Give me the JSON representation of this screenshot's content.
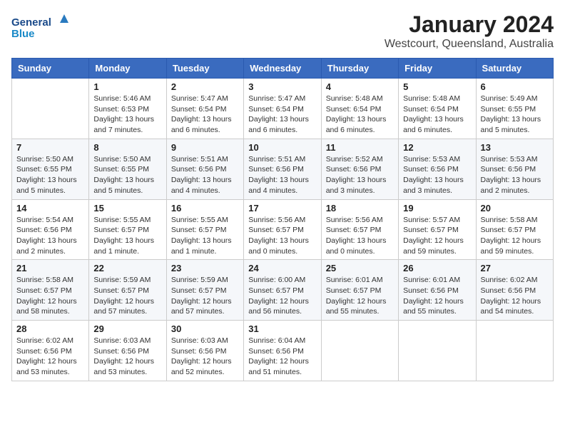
{
  "header": {
    "logo_text_general": "General",
    "logo_text_blue": "Blue",
    "title": "January 2024",
    "subtitle": "Westcourt, Queensland, Australia"
  },
  "calendar": {
    "days_of_week": [
      "Sunday",
      "Monday",
      "Tuesday",
      "Wednesday",
      "Thursday",
      "Friday",
      "Saturday"
    ],
    "weeks": [
      [
        {
          "day": "",
          "info": ""
        },
        {
          "day": "1",
          "info": "Sunrise: 5:46 AM\nSunset: 6:53 PM\nDaylight: 13 hours and 7 minutes."
        },
        {
          "day": "2",
          "info": "Sunrise: 5:47 AM\nSunset: 6:54 PM\nDaylight: 13 hours and 6 minutes."
        },
        {
          "day": "3",
          "info": "Sunrise: 5:47 AM\nSunset: 6:54 PM\nDaylight: 13 hours and 6 minutes."
        },
        {
          "day": "4",
          "info": "Sunrise: 5:48 AM\nSunset: 6:54 PM\nDaylight: 13 hours and 6 minutes."
        },
        {
          "day": "5",
          "info": "Sunrise: 5:48 AM\nSunset: 6:54 PM\nDaylight: 13 hours and 6 minutes."
        },
        {
          "day": "6",
          "info": "Sunrise: 5:49 AM\nSunset: 6:55 PM\nDaylight: 13 hours and 5 minutes."
        }
      ],
      [
        {
          "day": "7",
          "info": "Sunrise: 5:50 AM\nSunset: 6:55 PM\nDaylight: 13 hours and 5 minutes."
        },
        {
          "day": "8",
          "info": "Sunrise: 5:50 AM\nSunset: 6:55 PM\nDaylight: 13 hours and 5 minutes."
        },
        {
          "day": "9",
          "info": "Sunrise: 5:51 AM\nSunset: 6:56 PM\nDaylight: 13 hours and 4 minutes."
        },
        {
          "day": "10",
          "info": "Sunrise: 5:51 AM\nSunset: 6:56 PM\nDaylight: 13 hours and 4 minutes."
        },
        {
          "day": "11",
          "info": "Sunrise: 5:52 AM\nSunset: 6:56 PM\nDaylight: 13 hours and 3 minutes."
        },
        {
          "day": "12",
          "info": "Sunrise: 5:53 AM\nSunset: 6:56 PM\nDaylight: 13 hours and 3 minutes."
        },
        {
          "day": "13",
          "info": "Sunrise: 5:53 AM\nSunset: 6:56 PM\nDaylight: 13 hours and 2 minutes."
        }
      ],
      [
        {
          "day": "14",
          "info": "Sunrise: 5:54 AM\nSunset: 6:56 PM\nDaylight: 13 hours and 2 minutes."
        },
        {
          "day": "15",
          "info": "Sunrise: 5:55 AM\nSunset: 6:57 PM\nDaylight: 13 hours and 1 minute."
        },
        {
          "day": "16",
          "info": "Sunrise: 5:55 AM\nSunset: 6:57 PM\nDaylight: 13 hours and 1 minute."
        },
        {
          "day": "17",
          "info": "Sunrise: 5:56 AM\nSunset: 6:57 PM\nDaylight: 13 hours and 0 minutes."
        },
        {
          "day": "18",
          "info": "Sunrise: 5:56 AM\nSunset: 6:57 PM\nDaylight: 13 hours and 0 minutes."
        },
        {
          "day": "19",
          "info": "Sunrise: 5:57 AM\nSunset: 6:57 PM\nDaylight: 12 hours and 59 minutes."
        },
        {
          "day": "20",
          "info": "Sunrise: 5:58 AM\nSunset: 6:57 PM\nDaylight: 12 hours and 59 minutes."
        }
      ],
      [
        {
          "day": "21",
          "info": "Sunrise: 5:58 AM\nSunset: 6:57 PM\nDaylight: 12 hours and 58 minutes."
        },
        {
          "day": "22",
          "info": "Sunrise: 5:59 AM\nSunset: 6:57 PM\nDaylight: 12 hours and 57 minutes."
        },
        {
          "day": "23",
          "info": "Sunrise: 5:59 AM\nSunset: 6:57 PM\nDaylight: 12 hours and 57 minutes."
        },
        {
          "day": "24",
          "info": "Sunrise: 6:00 AM\nSunset: 6:57 PM\nDaylight: 12 hours and 56 minutes."
        },
        {
          "day": "25",
          "info": "Sunrise: 6:01 AM\nSunset: 6:57 PM\nDaylight: 12 hours and 55 minutes."
        },
        {
          "day": "26",
          "info": "Sunrise: 6:01 AM\nSunset: 6:56 PM\nDaylight: 12 hours and 55 minutes."
        },
        {
          "day": "27",
          "info": "Sunrise: 6:02 AM\nSunset: 6:56 PM\nDaylight: 12 hours and 54 minutes."
        }
      ],
      [
        {
          "day": "28",
          "info": "Sunrise: 6:02 AM\nSunset: 6:56 PM\nDaylight: 12 hours and 53 minutes."
        },
        {
          "day": "29",
          "info": "Sunrise: 6:03 AM\nSunset: 6:56 PM\nDaylight: 12 hours and 53 minutes."
        },
        {
          "day": "30",
          "info": "Sunrise: 6:03 AM\nSunset: 6:56 PM\nDaylight: 12 hours and 52 minutes."
        },
        {
          "day": "31",
          "info": "Sunrise: 6:04 AM\nSunset: 6:56 PM\nDaylight: 12 hours and 51 minutes."
        },
        {
          "day": "",
          "info": ""
        },
        {
          "day": "",
          "info": ""
        },
        {
          "day": "",
          "info": ""
        }
      ]
    ]
  }
}
